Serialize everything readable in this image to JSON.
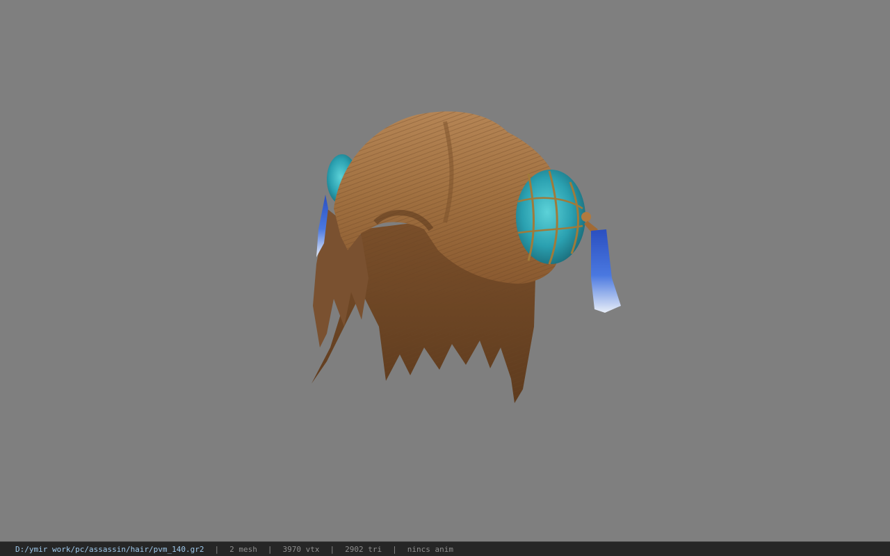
{
  "viewer": {
    "background_color": "#7f7f7f",
    "model_icon": "hair-mesh-icon"
  },
  "status_bar": {
    "file_path": "D:/ymir work/pc/assassin/hair/pvm_140.gr2",
    "separator": "|",
    "mesh_count": "2 mesh",
    "vertex_count": "3970 vtx",
    "triangle_count": "2902 tri",
    "anim_status": "nincs anim",
    "path_color": "#9fc9ec",
    "text_color": "#8e8e8e",
    "bar_color": "#262626"
  }
}
